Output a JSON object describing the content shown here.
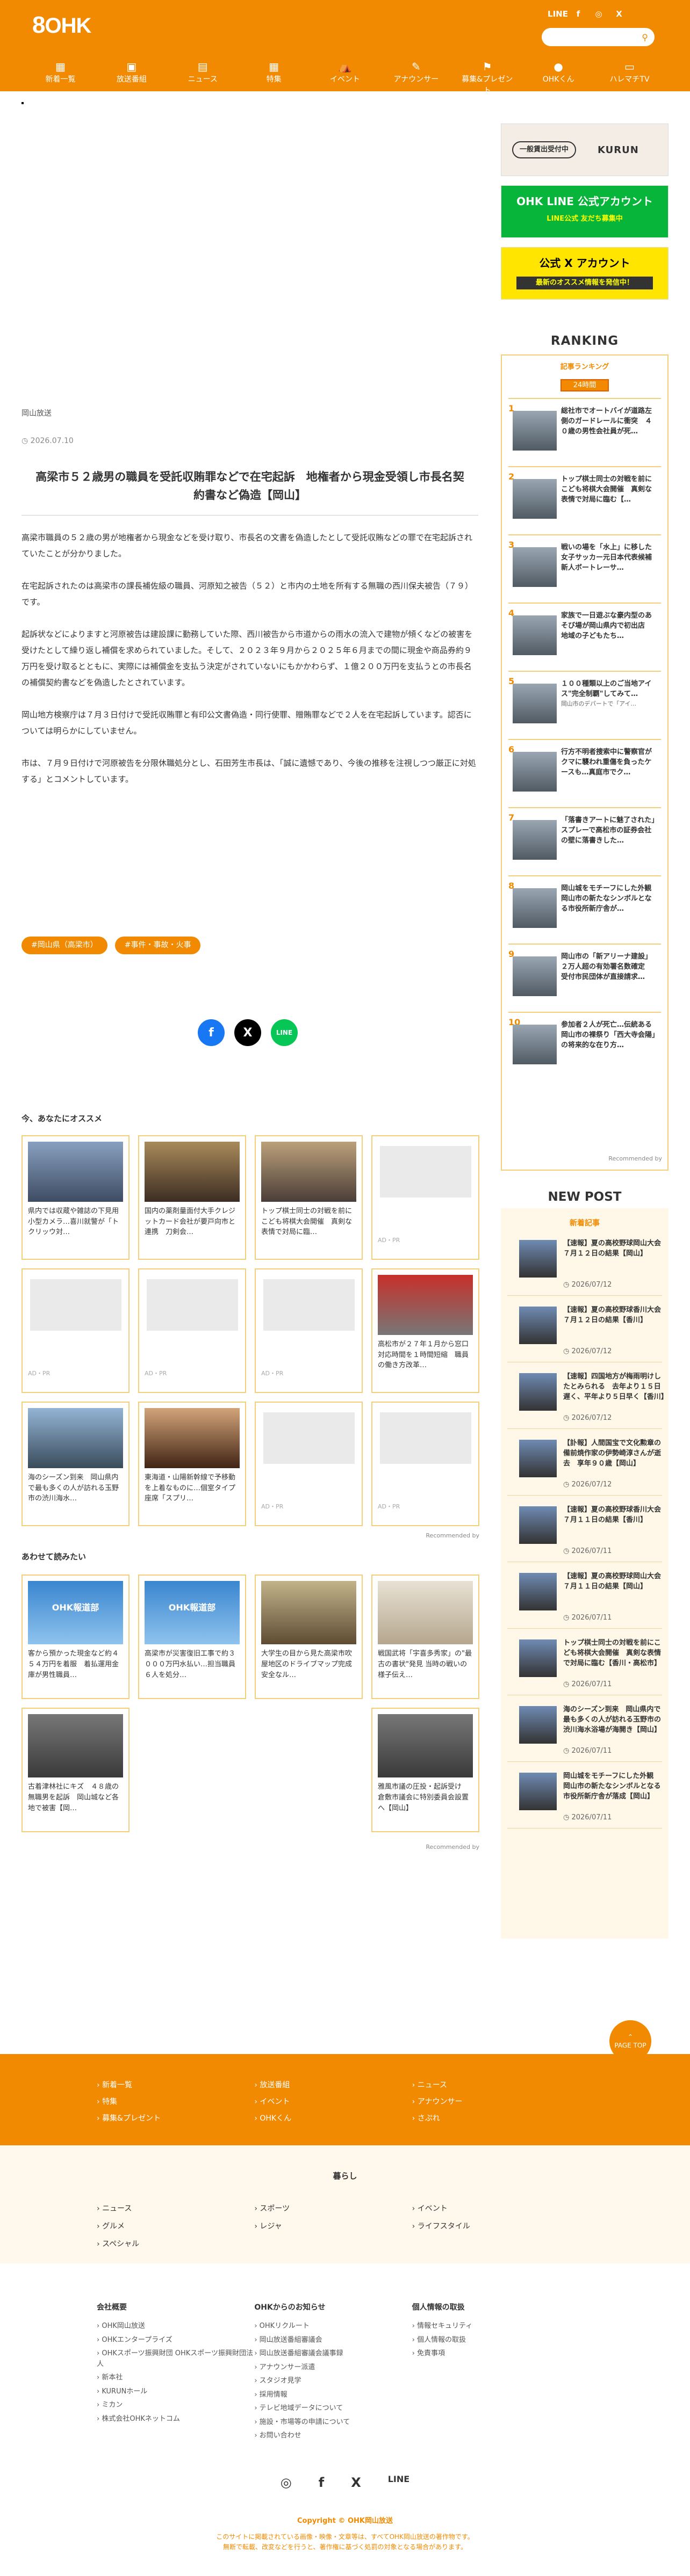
{
  "header": {
    "logo_mark": "8",
    "logo_text": "OHK",
    "social": [
      "LINE",
      "f",
      "◎",
      "X"
    ],
    "nav": [
      {
        "label": "新着一覧",
        "icon": "▦"
      },
      {
        "label": "放送番組",
        "icon": "▣"
      },
      {
        "label": "ニュース",
        "icon": "▤"
      },
      {
        "label": "特集",
        "icon": "▦"
      },
      {
        "label": "イベント",
        "icon": "⛺"
      },
      {
        "label": "アナウンサー",
        "icon": "✎"
      },
      {
        "label": "募集&プレゼント",
        "icon": "⚑"
      },
      {
        "label": "OHKくん",
        "icon": "●"
      },
      {
        "label": "ハレマチTV",
        "icon": "▭"
      }
    ]
  },
  "article": {
    "category": "岡山放送",
    "date": "2026.07.10",
    "title": "高梁市５２歳男の職員を受託収賄罪などで在宅起訴　地権者から現金受領し市長名契約書など偽造【岡山】",
    "paragraphs": [
      "高梁市職員の５２歳の男が地権者から現金などを受け取り、市長名の文書を偽造したとして受託収賄などの罪で在宅起訴されていたことが分かりました。",
      "在宅起訴されたのは高梁市の課長補佐級の職員、河原知之被告（５２）と市内の土地を所有する無職の西川保夫被告（７９）です。",
      "起訴状などによりますと河原被告は建設課に勤務していた際、西川被告から市道からの雨水の流入で建物が傾くなどの被害を受けたとして繰り返し補償を求められていました。そして、２０２３年９月から２０２５年６月までの間に現金や商品券約９万円を受け取るとともに、実際には補償金を支払う決定がされていないにもかかわらず、１億２００万円を支払うとの市長名の補償契約書などを偽造したとされています。",
      "岡山地方検察庁は７月３日付けで受託収賄罪と有印公文書偽造・同行使罪、贈賄罪などで２人を在宅起訴しています。認否については明らかにしていません。",
      "市は、７月９日付けで河原被告を分限休職処分とし、石田芳生市長は、「誠に遺憾であり、今後の推移を注視しつつ厳正に対処する」とコメントしています。"
    ],
    "tags": [
      "#岡山県（高梁市）",
      "#事件・事故・火事"
    ],
    "share": [
      "f",
      "X",
      "LINE"
    ]
  },
  "recommend": {
    "heading": "今、あなたにオススメ",
    "cards": [
      {
        "text": "県内では収蔵や雑誌の下見用小型カメラ…喜川就警が「トクリッウ対…",
        "pr": ""
      },
      {
        "text": "国内の薬剤量面付大手クレジットカード会社が要戸向市と連携　刀剣会…",
        "pr": ""
      },
      {
        "text": "トップ棋士同士の対戦を前にこども将棋大会開催　真剣な表情で対局に臨…",
        "pr": ""
      },
      {
        "text": "",
        "pr": "AD・PR"
      },
      {
        "text": "",
        "pr": "AD・PR"
      },
      {
        "text": "",
        "pr": "AD・PR"
      },
      {
        "text": "",
        "pr": "AD・PR"
      },
      {
        "text": "高松市が２７年１月から窓口対応時間を１時間短縮　職員の働き方改革…",
        "pr": ""
      },
      {
        "text": "海のシーズン到来　岡山県内で最も多くの人が訪れる玉野市の渋川海水…",
        "pr": ""
      },
      {
        "text": "東海道・山陽新幹線で予移動を上着なものに…個室タイプ座席「スプリ…",
        "pr": ""
      },
      {
        "text": "",
        "pr": "AD・PR"
      },
      {
        "text": "",
        "pr": "AD・PR"
      }
    ],
    "recommended_by": "Recommended by"
  },
  "also": {
    "heading": "あわせて読みたい",
    "cards": [
      {
        "thumb": "OHK報道部",
        "text": "客から預かった現金など約４５４万円を着服　着払運用金庫が男性職員…"
      },
      {
        "thumb": "OHK報道部",
        "text": "高梁市が災害復旧工事で約３０００万円水払い…担当職員６人を処分…"
      },
      {
        "thumb": "",
        "text": "大学生の目から見た高梁市吹屋地区のドライブマップ完成　安全なル…"
      },
      {
        "thumb": "",
        "text": "戦国武将「宇喜多秀家」の\"最古の書状\"発見 当時の戦いの様子伝え…"
      },
      {
        "thumb": "",
        "text": "古着津林社にキズ　４８歳の無職男を起訴　岡山城など各地で被害【岡…"
      },
      {
        "thumb": "",
        "text": "雅風市議の圧投・起訴受け　倉敷市議会に特別委員会設置へ【岡山】"
      }
    ],
    "recommended_by": "Recommended by"
  },
  "sidebar": {
    "banner1_badge": "一般賃出受付中",
    "banner1_brand": "KURUN",
    "banner2_title": "OHK LINE 公式アカウント",
    "banner2_sub": "LINE公式 友だち募集中",
    "banner3_title": "公式 X アカウント",
    "banner3_sub": "最新のオススメ情報を発信中！",
    "ranking_title": "RANKING",
    "ranking_sub": "記事ランキング",
    "ranking_tab": "24時間",
    "ranking": [
      {
        "n": "1",
        "t": "総社市でオートバイが道路左側のガードレールに衝突　４０歳の男性会社員が死…",
        "s": ""
      },
      {
        "n": "2",
        "t": "トップ棋士同士の対戦を前にこども将棋大会開催　真剣な表情で対局に臨む【…",
        "s": ""
      },
      {
        "n": "3",
        "t": "戦いの場を「水上」に移した女子サッカー元日本代表候補　新人ボートレーサ…",
        "s": ""
      },
      {
        "n": "4",
        "t": "家族で一日遊ぶな豪内型のあそび場が岡山県内で初出店　地域の子どもたち…",
        "s": ""
      },
      {
        "n": "5",
        "t": "１００種類以上のご当地アイス\"完全制覇\"してみて…",
        "s": "岡山市のデパートで「アイ…"
      },
      {
        "n": "6",
        "t": "行方不明者捜索中に警察官がクマに襲われ重傷を負ったケースも…真庭市でク…",
        "s": ""
      },
      {
        "n": "7",
        "t": "「落書きアートに魅了された」スプレーで高松市の証券会社の壁に落書きした…",
        "s": ""
      },
      {
        "n": "8",
        "t": "岡山城をモチーフにした外観　岡山市の新たなシンボルとなる市役所新庁舎が…",
        "s": ""
      },
      {
        "n": "9",
        "t": "岡山市の「新アリーナ建設」２万人超の有効署名数確定　受付市民団体が直接請求…",
        "s": ""
      },
      {
        "n": "10",
        "t": "参加者２人が死亡…伝統ある岡山市の裸祭り「西大寺会陽」の将来的な在り方…",
        "s": ""
      }
    ],
    "ranking_rec": "Recommended by",
    "newpost_title": "NEW POST",
    "newpost_sub": "新着記事",
    "newpost": [
      {
        "t": "【速報】夏の高校野球岡山大会　７月１２日の結果【岡山】",
        "d": "2026/07/12"
      },
      {
        "t": "【速報】夏の高校野球香川大会　７月１２日の結果【香川】",
        "d": "2026/07/12"
      },
      {
        "t": "【速報】四国地方が梅雨明けしたとみられる　去年より１５日遅く、平年より５日早く【香川】",
        "d": "2026/07/12"
      },
      {
        "t": "【訃報】人間国宝で文化勲章の備前焼作家の伊勢崎淳さんが逝去　享年９０歳【岡山】",
        "d": "2026/07/12"
      },
      {
        "t": "【速報】夏の高校野球香川大会　７月１１日の結果【香川】",
        "d": "2026/07/11"
      },
      {
        "t": "【速報】夏の高校野球岡山大会　７月１１日の結果【岡山】",
        "d": "2026/07/11"
      },
      {
        "t": "トップ棋士同士の対戦を前にこども将棋大会開催　真剣な表情で対局に臨む【香川・高松市】",
        "d": "2026/07/11"
      },
      {
        "t": "海のシーズン到来　岡山県内で最も多くの人が訪れる玉野市の渋川海水浴場が海開き【岡山】",
        "d": "2026/07/11"
      },
      {
        "t": "岡山城をモチーフにした外観　岡山市の新たなシンボルとなる市役所新庁舎が落成【岡山】",
        "d": "2026/07/11"
      }
    ]
  },
  "pagetop": "PAGE TOP",
  "footer": {
    "orange_links": [
      "新着一覧",
      "放送番組",
      "ニュース",
      "特集",
      "イベント",
      "アナウンサー",
      "募集&プレゼント",
      "OHKくん",
      "さぷれ"
    ],
    "kurashi_label": "暮らし",
    "kurashi_links": [
      "ニュース",
      "スポーツ",
      "イベント",
      "グルメ",
      "レジャ",
      "ライフスタイル",
      "スペシャル"
    ],
    "col1_head": "会社概要",
    "col1": [
      "OHK岡山放送",
      "OHKエンタープライズ",
      "OHKスポーツ振興財団 OHKスポーツ振興財団法人",
      "新本社",
      "KURUNホール",
      "ミカン",
      "株式会社OHKネットコム"
    ],
    "col2_head": "OHKからのお知らせ",
    "col2": [
      "OHKリクルート",
      "岡山放送番組審議会",
      "岡山放送番組審議会議事録",
      "アナウンサー派遣",
      "スタジオ見学",
      "採用情報",
      "テレビ地域データについて",
      "施設・市場等の申請について",
      "お問い合わせ"
    ],
    "col3_head": "個人情報の取扱",
    "col3": [
      "情報セキュリティ",
      "個人情報の取扱",
      "免責事項"
    ],
    "social": [
      "◎",
      "f",
      "X",
      "LINE"
    ],
    "copyright": "Copyright © OHK岡山放送",
    "note1": "このサイトに掲載されている画像・映像・文章等は、すべてOHK岡山放送の著作物です。",
    "note2": "無断で転載、改変などを行うと、著作権に基づく処罰の対象となる場合があります。"
  },
  "colors": {
    "brand": "#f18a00",
    "line": "#07b53b",
    "card_border": "#f4cf79"
  }
}
